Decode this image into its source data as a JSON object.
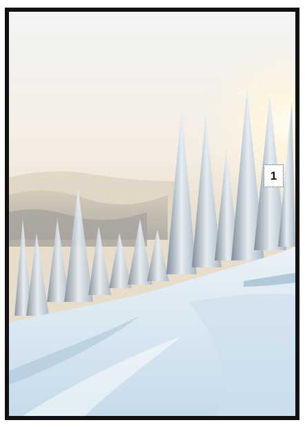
{
  "image": {
    "subject": "snowy-forest-sunrise",
    "colors": {
      "frame": "#111111",
      "sky_top": "#f4f5f4",
      "sky_glow": "#f2e6d2",
      "mountains": "#c9c3b6",
      "tree_shadow": "#6e7f8e",
      "tree_snow": "#e8eef3",
      "snow_light": "#eef4f8",
      "snow_shadow": "#b9d0e0",
      "sun": "#fffbe9"
    }
  },
  "marker": {
    "label": "1"
  }
}
